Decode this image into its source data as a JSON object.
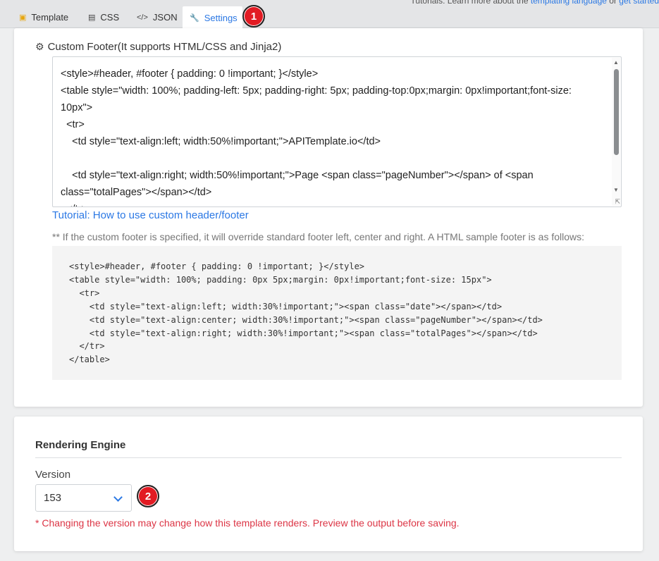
{
  "top_hint": {
    "prefix": "Tutorials: Learn more about the ",
    "link1": "templating language",
    "middle": " or ",
    "link2": "get started"
  },
  "tabs": [
    {
      "label": "Template",
      "icon": "html5-icon"
    },
    {
      "label": "CSS",
      "icon": "css3-icon"
    },
    {
      "label": "JSON",
      "icon": "code-icon"
    },
    {
      "label": "Settings",
      "icon": "wrench-icon"
    }
  ],
  "active_tab": "Settings",
  "annotations": {
    "badge1": "1",
    "badge2": "2"
  },
  "custom_footer": {
    "title": "Custom Footer(It supports HTML/CSS and Jinja2)",
    "editor_value": "<style>#header, #footer { padding: 0 !important; }</style>\n<table style=\"width: 100%; padding-left: 5px; padding-right: 5px; padding-top:0px;margin: 0px!important;font-size: 10px\">\n  <tr>\n    <td style=\"text-align:left; width:50%!important;\">APITemplate.io</td>\n\n    <td style=\"text-align:right; width:50%!important;\">Page <span class=\"pageNumber\"></span> of <span class=\"totalPages\"></span></td>\n  </tr>",
    "tutorial_link": "Tutorial: How to use custom header/footer",
    "note": "** If the custom footer is specified, it will override standard footer left, center and right. A HTML sample footer is as follows:",
    "sample_code": "<style>#header, #footer { padding: 0 !important; }</style>\n<table style=\"width: 100%; padding: 0px 5px;margin: 0px!important;font-size: 15px\">\n  <tr>\n    <td style=\"text-align:left; width:30%!important;\"><span class=\"date\"></span></td>\n    <td style=\"text-align:center; width:30%!important;\"><span class=\"pageNumber\"></span></td>\n    <td style=\"text-align:right; width:30%!important;\"><span class=\"totalPages\"></span></td>\n  </tr>\n</table>"
  },
  "rendering_engine": {
    "title": "Rendering Engine",
    "version_label": "Version",
    "version_value": "153",
    "warning": "* Changing the version may change how this template renders. Preview the output before saving."
  },
  "colors": {
    "accent": "#2b78e4",
    "danger": "#dc3545",
    "badge": "#e21b23"
  }
}
